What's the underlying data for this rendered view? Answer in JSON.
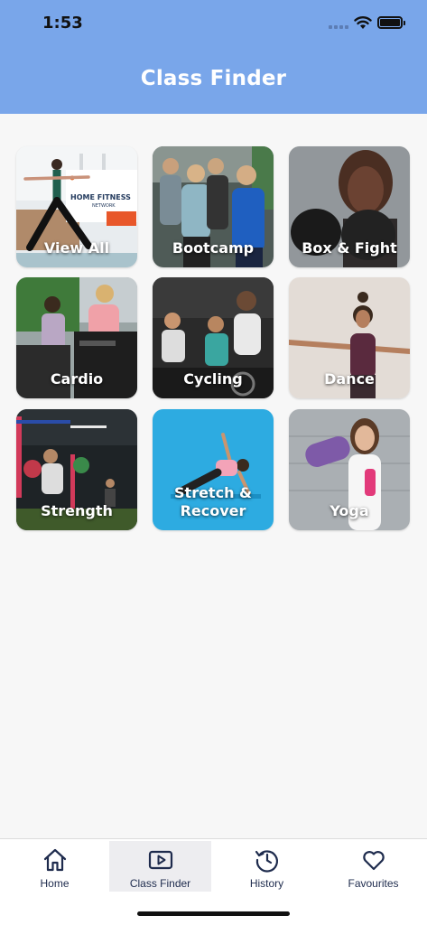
{
  "status_bar": {
    "time": "1:53",
    "icons": [
      "cellular-icon",
      "wifi-icon",
      "battery-icon"
    ]
  },
  "header": {
    "title": "Class Finder",
    "background_color": "#79a6ea"
  },
  "categories": [
    {
      "label": "View All",
      "image_text": "HOME FITNESS",
      "image_subtext": "NETWORK"
    },
    {
      "label": "Bootcamp"
    },
    {
      "label": "Box & Fight"
    },
    {
      "label": "Cardio"
    },
    {
      "label": "Cycling"
    },
    {
      "label": "Dance"
    },
    {
      "label": "Strength"
    },
    {
      "label": "Stretch & Recover"
    },
    {
      "label": "Yoga"
    }
  ],
  "tab_bar": {
    "tabs": [
      {
        "label": "Home",
        "icon": "home-icon",
        "active": false
      },
      {
        "label": "Class Finder",
        "icon": "video-play-icon",
        "active": true
      },
      {
        "label": "History",
        "icon": "history-icon",
        "active": false
      },
      {
        "label": "Favourites",
        "icon": "heart-icon",
        "active": false
      }
    ],
    "icon_color": "#1e2b4d"
  }
}
